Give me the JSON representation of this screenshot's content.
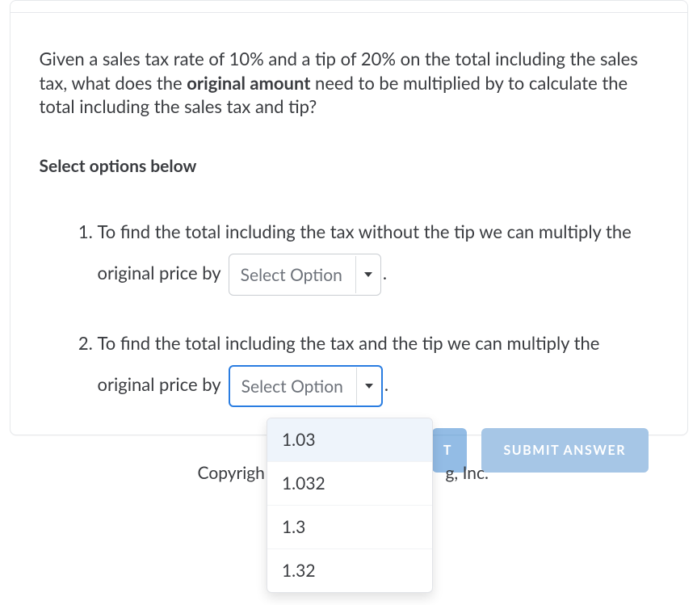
{
  "question": {
    "text_1": "Given a sales tax rate of ",
    "rate1": "10%",
    "text_2": " and a tip of ",
    "rate2": "20%",
    "text_3": " on the total including the sales tax, what does the ",
    "bold": "original amount",
    "text_4": " need to be multiplied by to calculate the total including the sales tax and tip?"
  },
  "instruction": "Select options below",
  "steps": [
    {
      "before": "To find the total including the tax without the tip we can multiply the original price by",
      "select_placeholder": "Select Option",
      "after": "."
    },
    {
      "before": "To find the total including the tax and the tip we can multiply the original price by",
      "select_placeholder": "Select Option",
      "after": "."
    }
  ],
  "dropdown_options": [
    "1.03",
    "1.032",
    "1.3",
    "1.32"
  ],
  "buttons": {
    "partial_visible": "T",
    "submit": "SUBMIT ANSWER"
  },
  "footer": {
    "left": "Copyrigh",
    "right": "g, Inc."
  }
}
